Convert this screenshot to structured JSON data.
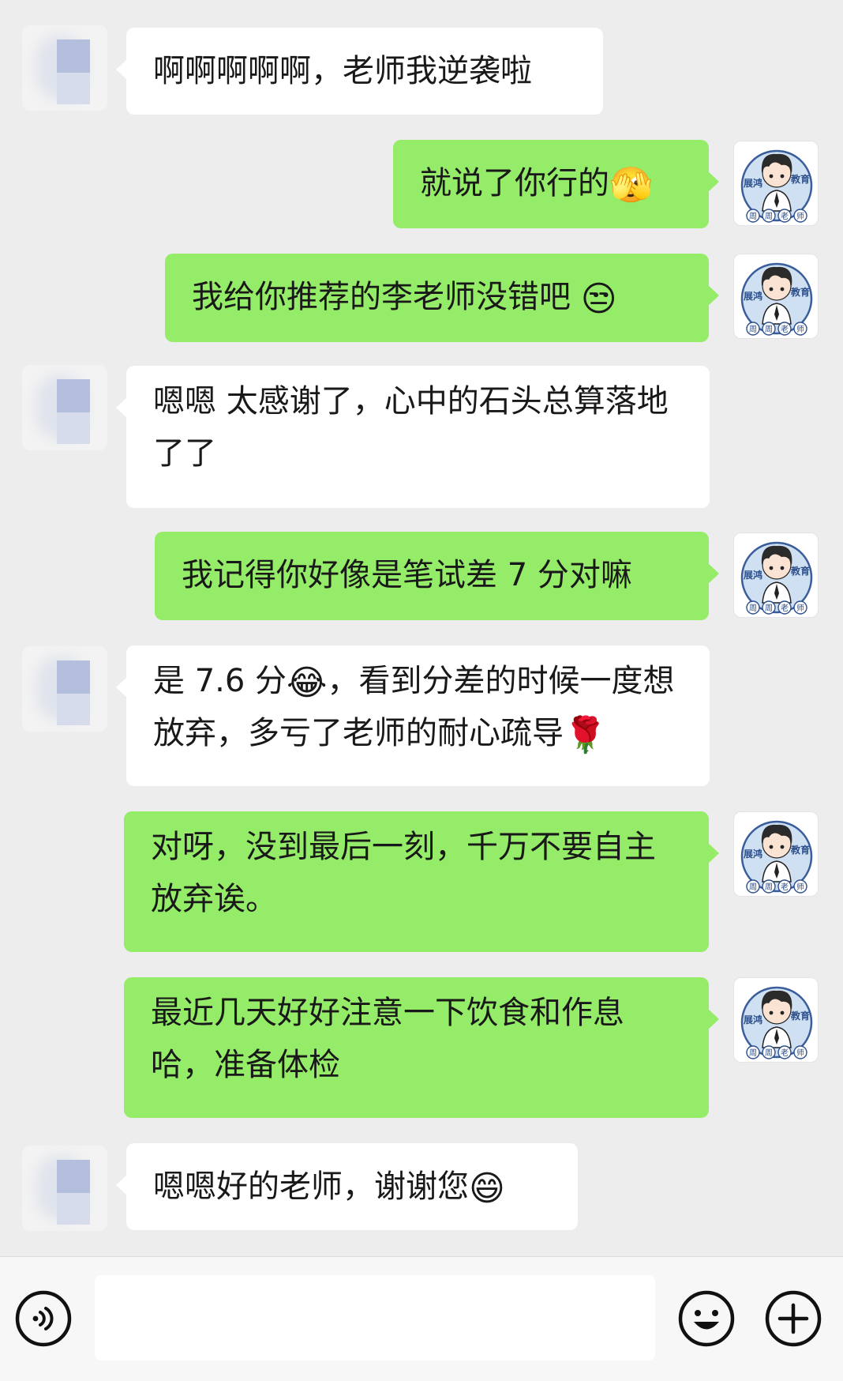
{
  "messages": [
    {
      "from": "contact",
      "text": "啊啊啊啊啊，老师我逆袭啦",
      "emoji": ""
    },
    {
      "from": "teacher",
      "text": "就说了你行的",
      "emoji": "🫣"
    },
    {
      "from": "teacher",
      "text": "我给你推荐的李老师没错吧 ",
      "emoji": "😒"
    },
    {
      "from": "contact",
      "text": "嗯嗯 太感谢了，心中的石头总算落地了了",
      "emoji": ""
    },
    {
      "from": "teacher",
      "text": "我记得你好像是笔试差 7 分对嘛",
      "emoji": ""
    },
    {
      "from": "contact",
      "text_a": "是 7.6 分",
      "emoji_a": "😂",
      "text_b": "，看到分差的时候一度想放弃，多亏了老师的耐心疏导",
      "emoji_b": "🌹"
    },
    {
      "from": "teacher",
      "text": "对呀，没到最后一刻，千万不要自主放弃诶。",
      "emoji": ""
    },
    {
      "from": "teacher",
      "text": "最近几天好好注意一下饮食和作息哈，准备体检",
      "emoji": ""
    },
    {
      "from": "contact",
      "text": "嗯嗯好的老师，谢谢您",
      "emoji": "😄"
    }
  ],
  "teacher_avatar": {
    "brand_left": "展鸿",
    "brand_right": "教育",
    "name_chars": [
      "周",
      "周",
      "老",
      "师"
    ]
  },
  "input_bar": {
    "text_value": "",
    "voice_icon": "voice-icon",
    "emoji_icon": "emoji-icon",
    "plus_icon": "plus-icon"
  },
  "colors": {
    "background": "#ededed",
    "incoming_bubble": "#ffffff",
    "outgoing_bubble": "#95ec69",
    "text": "#191919"
  }
}
